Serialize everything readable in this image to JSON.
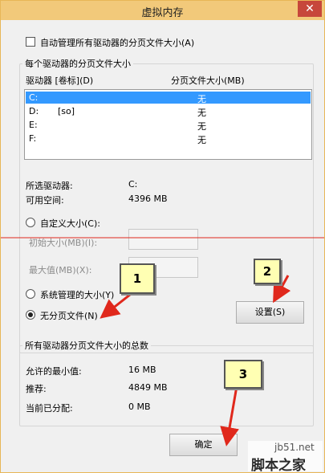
{
  "window": {
    "title": "虚拟内存",
    "close_glyph": "✕"
  },
  "auto_manage": {
    "label": "自动管理所有驱动器的分页文件大小(A)",
    "checked": false
  },
  "drives_group": {
    "legend": "每个驱动器的分页文件大小",
    "col_drive": "驱动器 [卷标](D)",
    "col_size": "分页文件大小(MB)",
    "rows": [
      {
        "drive": "C:",
        "label": "",
        "size": "无",
        "selected": true
      },
      {
        "drive": "D:",
        "label": "[so]",
        "size": "无",
        "selected": false
      },
      {
        "drive": "E:",
        "label": "",
        "size": "无",
        "selected": false
      },
      {
        "drive": "F:",
        "label": "",
        "size": "无",
        "selected": false
      }
    ],
    "selected_drive_label": "所选驱动器:",
    "selected_drive_value": "C:",
    "free_space_label": "可用空间:",
    "free_space_value": "4396 MB",
    "custom_size_label": "自定义大小(C):",
    "initial_size_label": "初始大小(MB)(I):",
    "initial_size_value": "",
    "max_size_label": "最大值(MB)(X):",
    "max_size_value": "",
    "system_managed_label": "系统管理的大小(Y)",
    "no_paging_label": "无分页文件(N)",
    "selected_option": "no_paging",
    "set_button": "设置(S)"
  },
  "totals_group": {
    "legend": "所有驱动器分页文件大小的总数",
    "min_allowed_label": "允许的最小值:",
    "min_allowed_value": "16 MB",
    "recommended_label": "推荐:",
    "recommended_value": "4849 MB",
    "current_label": "当前已分配:",
    "current_value": "0 MB"
  },
  "ok_button": "确定",
  "annotations": {
    "callout_1": "1",
    "callout_2": "2",
    "callout_3": "3",
    "arrow_color": "#e0281c"
  },
  "watermark": {
    "line1": "jb51.net",
    "line2": "脚本之家"
  }
}
